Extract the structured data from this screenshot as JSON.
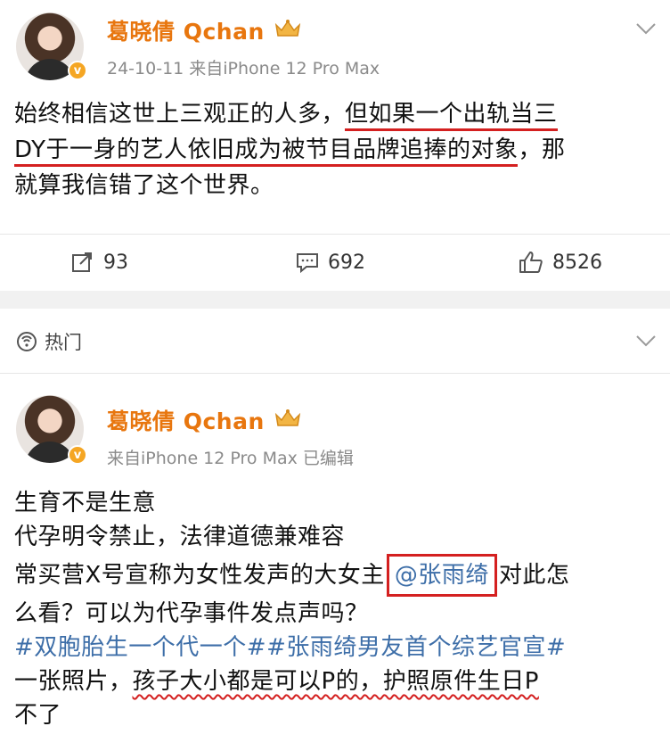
{
  "post1": {
    "username": "葛晓倩 Qchan",
    "meta": "24-10-11  来自iPhone 12 Pro Max",
    "text_a": "始终相信这世上三观正的人多，",
    "text_b": "但如果一个出轨当三",
    "text_c": "DY于一身的艺人依旧成为被节目品牌追捧的对象",
    "text_d": "，那",
    "text_e": "就算我信错了这个世界。",
    "reposts": "93",
    "comments": "692",
    "likes": "8526"
  },
  "section": {
    "label": "热门"
  },
  "post2": {
    "username": "葛晓倩 Qchan",
    "meta": "来自iPhone 12 Pro Max  已编辑",
    "line1": "生育不是生意",
    "line2": "代孕明令禁止，法律道德兼难容",
    "line3a": "常买营X号宣称为女性发声的大女主",
    "mention": "@张雨绮",
    "line3b": "对此怎",
    "line4": "么看？可以为代孕事件发点声吗？",
    "topics": "#双胞胎生一个代一个##张雨绮男友首个综艺官宣#",
    "line6a": "一张照片，",
    "line6b": "孩子大小都是可以P的，护照原件生日P",
    "line7": "不了"
  },
  "colors": {
    "username": "#e8760e",
    "link": "#3d6ea8",
    "annotation_red": "#d42020"
  }
}
